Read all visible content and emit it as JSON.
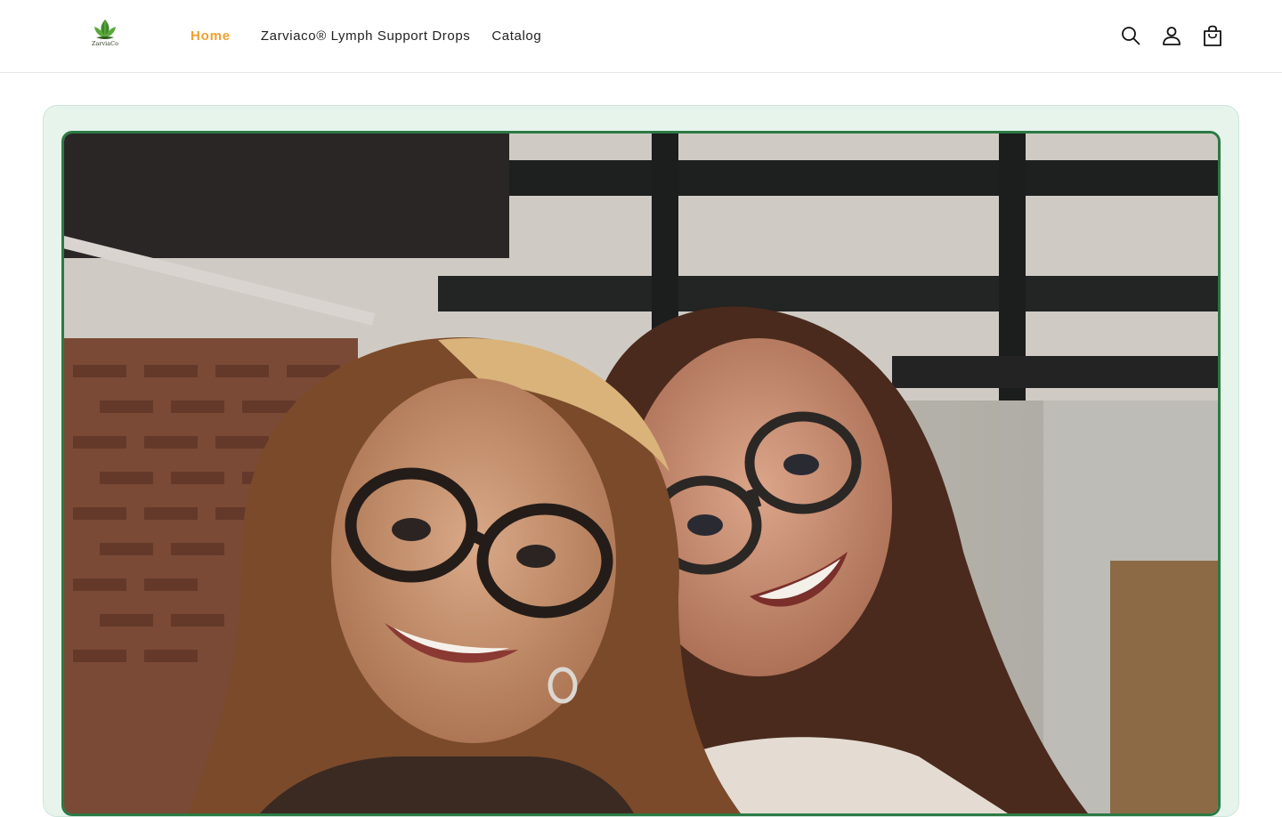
{
  "brand": {
    "logo_text": "ZarviaCo"
  },
  "nav": {
    "items": [
      {
        "label": "Home",
        "active": true
      },
      {
        "label": "Zarviaco® Lymph Support Drops",
        "active": false
      },
      {
        "label": "Catalog",
        "active": false
      }
    ]
  },
  "header_icons": [
    "search-icon",
    "account-icon",
    "cart-icon"
  ],
  "colors": {
    "accent_active": "#f0a030",
    "hero_border": "#2c7a44",
    "frame_background": "#e6f4ec"
  }
}
